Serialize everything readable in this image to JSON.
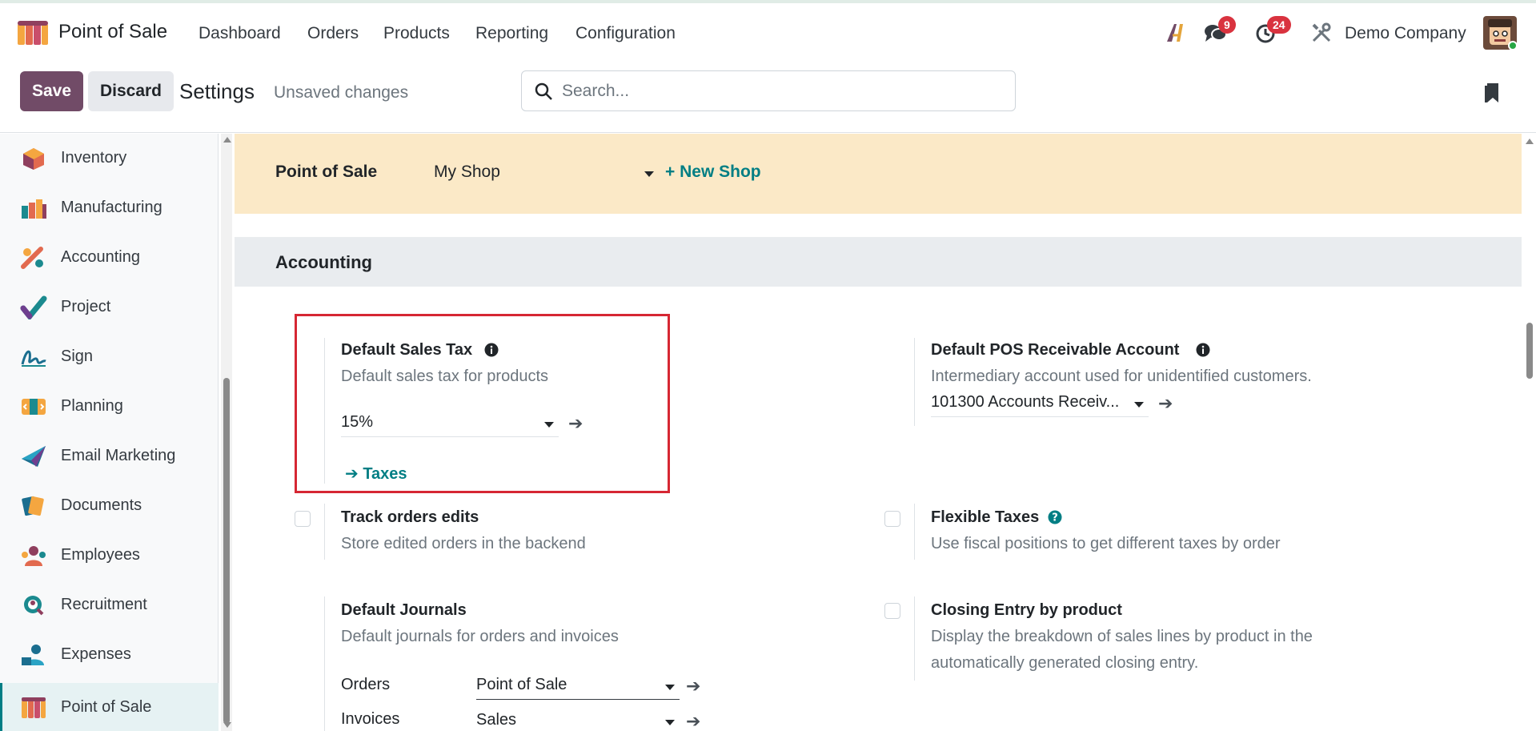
{
  "navbar": {
    "app_name": "Point of Sale",
    "menu": [
      "Dashboard",
      "Orders",
      "Products",
      "Reporting",
      "Configuration"
    ],
    "messages_count": "9",
    "activities_count": "24",
    "company": "Demo Company"
  },
  "control_panel": {
    "save_label": "Save",
    "discard_label": "Discard",
    "title": "Settings",
    "status": "Unsaved changes",
    "search_placeholder": "Search..."
  },
  "sidebar": {
    "items": [
      {
        "label": "Inventory",
        "icon": "inventory-icon"
      },
      {
        "label": "Manufacturing",
        "icon": "manufacturing-icon"
      },
      {
        "label": "Accounting",
        "icon": "accounting-icon"
      },
      {
        "label": "Project",
        "icon": "project-icon"
      },
      {
        "label": "Sign",
        "icon": "sign-icon"
      },
      {
        "label": "Planning",
        "icon": "planning-icon"
      },
      {
        "label": "Email Marketing",
        "icon": "email-marketing-icon"
      },
      {
        "label": "Documents",
        "icon": "documents-icon"
      },
      {
        "label": "Employees",
        "icon": "employees-icon"
      },
      {
        "label": "Recruitment",
        "icon": "recruitment-icon"
      },
      {
        "label": "Expenses",
        "icon": "expenses-icon"
      },
      {
        "label": "Point of Sale",
        "icon": "point-of-sale-icon",
        "active": true
      }
    ]
  },
  "shop_bar": {
    "label": "Point of Sale",
    "selected_shop": "My Shop",
    "new_shop": "+ New Shop"
  },
  "section": {
    "title": "Accounting"
  },
  "settings": {
    "default_sales_tax": {
      "title": "Default Sales Tax",
      "desc": "Default sales tax for products",
      "value": "15%",
      "link": "Taxes"
    },
    "default_pos_receivable": {
      "title": "Default POS Receivable Account",
      "desc": "Intermediary account used for unidentified customers.",
      "value": "101300 Accounts Receiv..."
    },
    "track_orders_edits": {
      "title": "Track orders edits",
      "desc": "Store edited orders in the backend"
    },
    "flexible_taxes": {
      "title": "Flexible Taxes",
      "desc": "Use fiscal positions to get different taxes by order"
    },
    "default_journals": {
      "title": "Default Journals",
      "desc": "Default journals for orders and invoices",
      "orders_label": "Orders",
      "orders_value": "Point of Sale",
      "invoices_label": "Invoices",
      "invoices_value": "Sales"
    },
    "closing_entry": {
      "title": "Closing Entry by product",
      "desc_line1": "Display the breakdown of sales lines by product in the",
      "desc_line2": "automatically generated closing entry."
    }
  },
  "colors": {
    "brand": "#714b67",
    "link": "#017e84",
    "highlight_border": "#d62733",
    "shop_bar_bg": "#fbe9c7"
  }
}
